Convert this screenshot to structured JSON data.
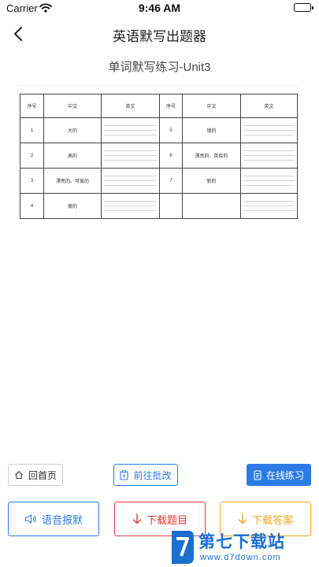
{
  "status_bar": {
    "carrier": "Carrier",
    "time": "9:46 AM"
  },
  "nav": {
    "title": "英语默写出题器"
  },
  "sheet": {
    "title": "单词默写练习-Unit3",
    "headers": [
      "序号",
      "中文",
      "英文",
      "序号",
      "中文",
      "英文"
    ],
    "rows": [
      {
        "left": {
          "num": "1",
          "cn": "大的"
        },
        "right": {
          "num": "5",
          "cn": "矮的"
        }
      },
      {
        "left": {
          "num": "2",
          "cn": "高的"
        },
        "right": {
          "num": "6",
          "cn": "漂亮的、英俊的"
        }
      },
      {
        "left": {
          "num": "3",
          "cn": "漂亮的、可爱的"
        },
        "right": {
          "num": "7",
          "cn": "新的"
        }
      },
      {
        "left": {
          "num": "4",
          "cn": "瘦的"
        },
        "right": {
          "num": "",
          "cn": ""
        }
      }
    ]
  },
  "actions": {
    "home": "回首页",
    "review": "前往批改",
    "online": "在线练习",
    "voice": "语音报默",
    "download_questions": "下载题目",
    "download_answers": "下载答案"
  },
  "watermark": {
    "name": "第七下载站",
    "url": "www.d7down.com"
  },
  "colors": {
    "blue": "#2c7be5",
    "red": "#e53935",
    "orange": "#f5a623",
    "watermark": "#1a6fd0"
  }
}
